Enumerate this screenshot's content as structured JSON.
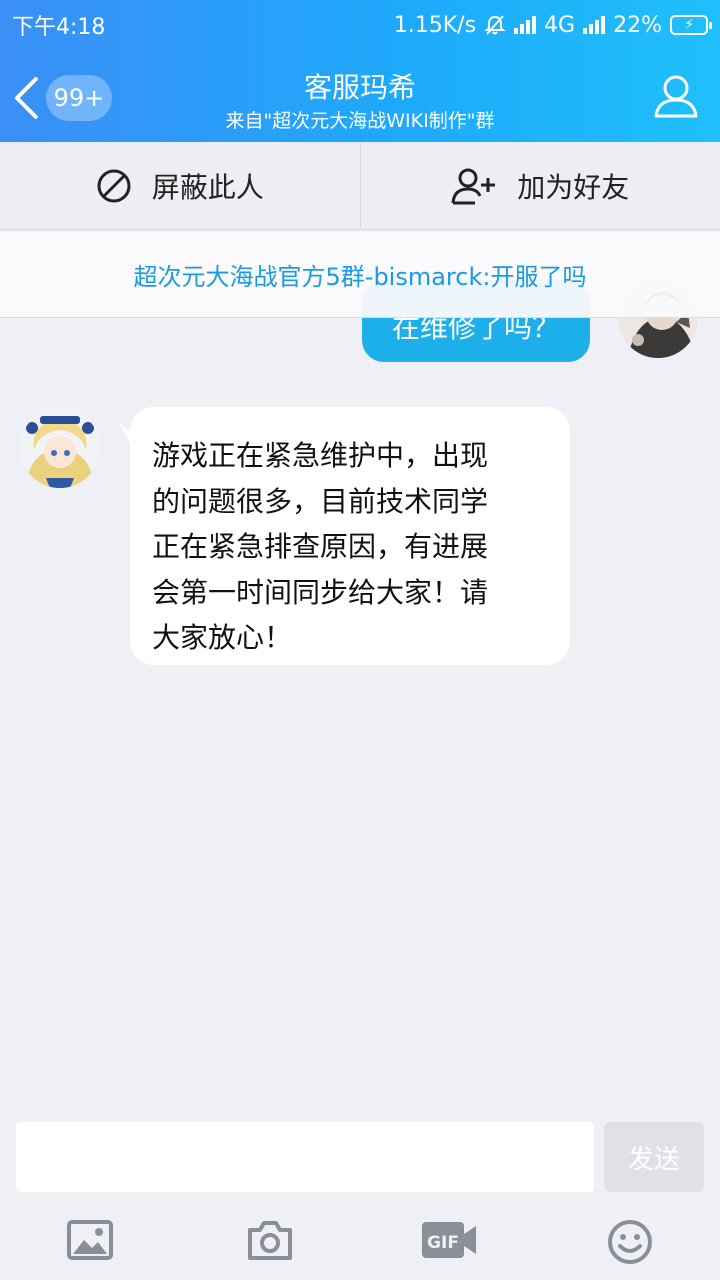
{
  "status": {
    "time": "下午4:18",
    "speed": "1.15K/s",
    "network": "4G",
    "battery": "22%"
  },
  "header": {
    "unread_count": "99+",
    "title": "客服玛希",
    "subtitle": "来自\"超次元大海战WIKI制作\"群"
  },
  "actions": {
    "block_label": "屏蔽此人",
    "add_friend_label": "加为好友"
  },
  "notice": {
    "text": "超次元大海战官方5群-bismarck:开服了吗"
  },
  "messages": {
    "outgoing": "在维修了吗？",
    "incoming_lines": [
      "游戏正在紧急维护中，出现",
      "的问题很多，目前技术同学",
      "正在紧急排查原因，有进展",
      "会第一时间同步给大家！请",
      "大家放心！"
    ]
  },
  "composer": {
    "input_value": "",
    "send_label": "发送"
  },
  "toolbar": {
    "icons": [
      "image-icon",
      "camera-icon",
      "gif-icon",
      "emoji-icon"
    ]
  },
  "colors": {
    "accent": "#1dafea",
    "header_start": "#3b8ff5",
    "header_end": "#1fc0fb",
    "notice_text": "#1a9ae6"
  }
}
